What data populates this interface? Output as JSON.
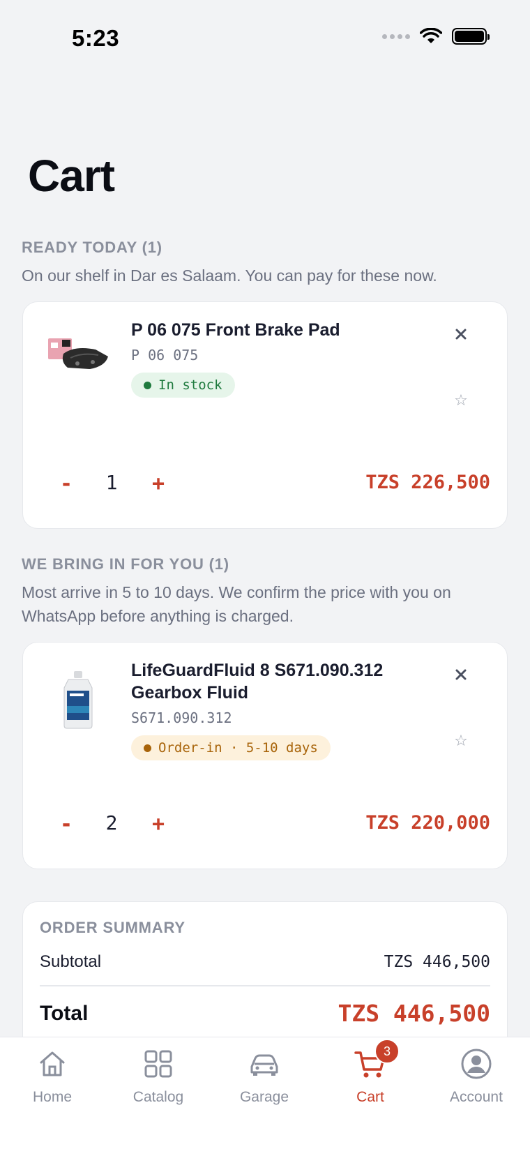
{
  "status_bar": {
    "time": "5:23"
  },
  "page": {
    "title": "Cart"
  },
  "sections": {
    "ready": {
      "heading": "READY TODAY (1)",
      "description": "On our shelf in Dar es Salaam. You can pay for these now."
    },
    "order_in": {
      "heading": "WE BRING IN FOR YOU (1)",
      "description": "Most arrive in 5 to 10 days. We confirm the price with you on WhatsApp before anything is charged."
    }
  },
  "items": [
    {
      "name": "P 06 075 Front Brake Pad",
      "sku": "P 06 075",
      "badge": "In stock",
      "quantity": "1",
      "price": "TZS 226,500",
      "minus": "-",
      "plus": "+",
      "icon": "brake-pad-image"
    },
    {
      "name": "LifeGuardFluid 8 S671.090.312 Gearbox Fluid",
      "sku": "S671.090.312",
      "badge": "Order-in · 5-10 days",
      "quantity": "2",
      "price": "TZS 220,000",
      "minus": "-",
      "plus": "+",
      "icon": "fluid-bottle-image"
    }
  ],
  "summary": {
    "heading": "ORDER SUMMARY",
    "subtotal_label": "Subtotal",
    "subtotal_value": "TZS 446,500",
    "total_label": "Total",
    "total_value": "TZS 446,500"
  },
  "tabs": [
    {
      "label": "Home",
      "icon": "home-icon"
    },
    {
      "label": "Catalog",
      "icon": "grid-icon"
    },
    {
      "label": "Garage",
      "icon": "car-icon"
    },
    {
      "label": "Cart",
      "icon": "cart-icon",
      "badge": "3",
      "active": true
    },
    {
      "label": "Account",
      "icon": "account-icon"
    }
  ],
  "colors": {
    "accent": "#c8402a",
    "in_stock": "#1f7a3e",
    "order_in": "#a8640a",
    "background": "#f2f3f5"
  }
}
